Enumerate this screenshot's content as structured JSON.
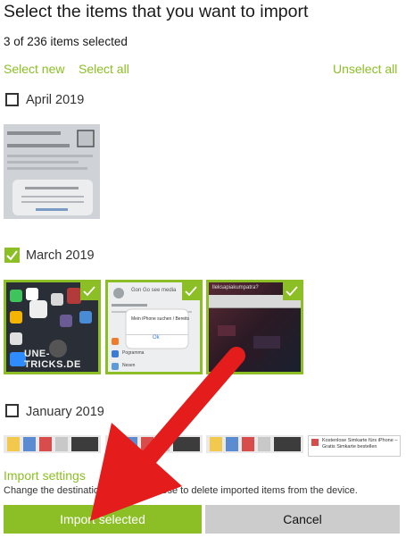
{
  "header": {
    "title": "Select the items that you want to import",
    "count": "3 of 236 items selected"
  },
  "links": {
    "select_new": "Select new",
    "select_all": "Select all",
    "unselect_all": "Unselect all"
  },
  "groups": [
    {
      "label": "April 2019",
      "checked": false
    },
    {
      "label": "March 2019",
      "checked": true
    },
    {
      "label": "January 2019",
      "checked": false
    }
  ],
  "thumbnails": {
    "april": {
      "selected": false
    },
    "march": [
      {
        "selected": true,
        "watermark": "UNE-TRICKS.DE"
      },
      {
        "selected": true,
        "header_text": "Gon Go see media",
        "popup_text": "Mein iPhone suchen / Bereits",
        "popup_ok": "Ok",
        "row1": "Pogramma",
        "row2": "Nesen"
      },
      {
        "selected": true,
        "header_text": "lleksapiakumpatra?"
      }
    ],
    "january_caption": "Kostenlose Simkarte fürs iPhone – Gratis Simkarte bestellen"
  },
  "footer": {
    "settings_link": "Import settings",
    "description": "Change the destination folder or choose to delete imported items from the device.",
    "import_button": "Import selected",
    "cancel_button": "Cancel"
  },
  "colors": {
    "accent": "#8cbf26",
    "arrow": "#e41c1c",
    "cancel_bg": "#cccccc"
  }
}
